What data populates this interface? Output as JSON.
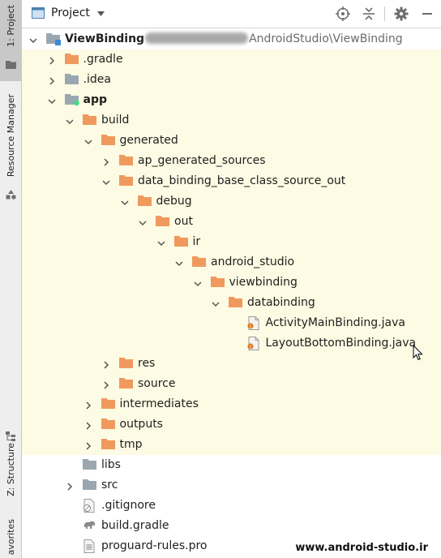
{
  "sidebar": {
    "project_tab": "1: Project",
    "resource_tab": "Resource Manager",
    "structure_tab": "Z: Structure",
    "favorites_tab": "avorites"
  },
  "header": {
    "title": "Project"
  },
  "root": {
    "name": "ViewBinding",
    "path_suffix": "AndroidStudio\\ViewBinding"
  },
  "tree": [
    {
      "label": "ViewBinding",
      "depth": 0,
      "expand": "open",
      "icon": "module-folder"
    },
    {
      "label": ".gradle",
      "depth": 1,
      "expand": "closed",
      "icon": "orange-folder"
    },
    {
      "label": ".idea",
      "depth": 1,
      "expand": "closed",
      "icon": "gray-folder"
    },
    {
      "label": "app",
      "depth": 1,
      "expand": "open",
      "icon": "android-module-folder"
    },
    {
      "label": "build",
      "depth": 2,
      "expand": "open",
      "icon": "orange-folder"
    },
    {
      "label": "generated",
      "depth": 3,
      "expand": "open",
      "icon": "orange-folder"
    },
    {
      "label": "ap_generated_sources",
      "depth": 4,
      "expand": "closed",
      "icon": "orange-folder"
    },
    {
      "label": "data_binding_base_class_source_out",
      "depth": 4,
      "expand": "open",
      "icon": "orange-folder"
    },
    {
      "label": "debug",
      "depth": 5,
      "expand": "open",
      "icon": "orange-folder"
    },
    {
      "label": "out",
      "depth": 6,
      "expand": "open",
      "icon": "orange-folder"
    },
    {
      "label": "ir",
      "depth": 7,
      "expand": "open",
      "icon": "orange-folder"
    },
    {
      "label": "android_studio",
      "depth": 8,
      "expand": "open",
      "icon": "orange-folder"
    },
    {
      "label": "viewbinding",
      "depth": 9,
      "expand": "open",
      "icon": "orange-folder"
    },
    {
      "label": "databinding",
      "depth": 10,
      "expand": "open",
      "icon": "orange-folder"
    },
    {
      "label": "ActivityMainBinding.java",
      "depth": 11,
      "expand": "none",
      "icon": "java-file"
    },
    {
      "label": "LayoutBottomBinding.java",
      "depth": 11,
      "expand": "none",
      "icon": "java-file"
    },
    {
      "label": "res",
      "depth": 4,
      "expand": "closed",
      "icon": "orange-folder"
    },
    {
      "label": "source",
      "depth": 4,
      "expand": "closed",
      "icon": "orange-folder"
    },
    {
      "label": "intermediates",
      "depth": 3,
      "expand": "closed",
      "icon": "orange-folder"
    },
    {
      "label": "outputs",
      "depth": 3,
      "expand": "closed",
      "icon": "orange-folder"
    },
    {
      "label": "tmp",
      "depth": 3,
      "expand": "closed",
      "icon": "orange-folder"
    },
    {
      "label": "libs",
      "depth": 2,
      "expand": "none",
      "icon": "gray-folder"
    },
    {
      "label": "src",
      "depth": 2,
      "expand": "closed",
      "icon": "gray-folder"
    },
    {
      "label": ".gitignore",
      "depth": 2,
      "expand": "none",
      "icon": "gitignore-file"
    },
    {
      "label": "build.gradle",
      "depth": 2,
      "expand": "none",
      "icon": "gradle-file"
    },
    {
      "label": "proguard-rules.pro",
      "depth": 2,
      "expand": "none",
      "icon": "text-file"
    }
  ],
  "watermark": "www.android-studio.ir",
  "colors": {
    "highlight": "#fdfbe3",
    "orange_folder": "#f0995e",
    "gray_folder": "#9aa7b0",
    "selection_strip": "#c8c8c8"
  }
}
